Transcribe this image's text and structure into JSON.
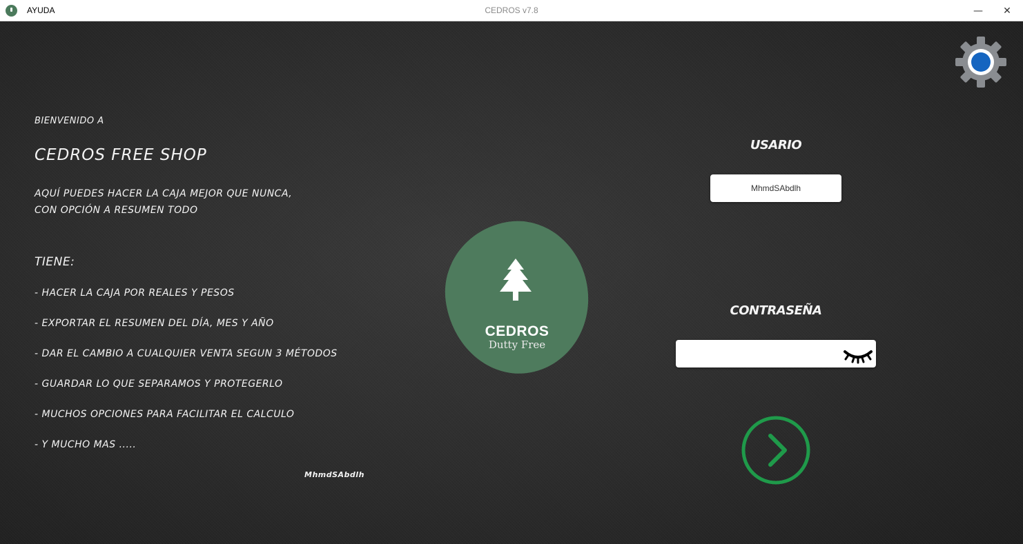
{
  "window": {
    "title": "CEDROS v7.8",
    "menu_ayuda": "AYUDA",
    "minimize_glyph": "—",
    "close_glyph": "✕"
  },
  "welcome": {
    "greeting": "BIENVENIDO A",
    "shop_name": "CEDROS FREE SHOP",
    "intro_line1": "AQUÍ PUEDES HACER LA CAJA MEJOR QUE NUNCA,",
    "intro_line2": "CON OPCIÓN A RESUMEN TODO",
    "features_title": "TIENE:",
    "features": [
      "- HACER LA CAJA POR REALES Y PESOS",
      "- EXPORTAR EL RESUMEN DEL DÍA, MES Y AÑO",
      "- DAR EL CAMBIO A CUALQUIER VENTA SEGUN 3 MÉTODOS",
      "- GUARDAR LO QUE SEPARAMOS Y PROTEGERLO",
      "- MUCHOS OPCIONES PARA FACILITAR EL CALCULO",
      "- Y MUCHO MAS ....."
    ],
    "signature": "MhmdSAbdlh"
  },
  "logo": {
    "brand": "CEDROS",
    "subtitle": "Dutty Free",
    "icon": "tree-icon",
    "color": "#4e7b5d"
  },
  "login": {
    "user_label": "USARIO",
    "user_value": "MhmdSAbdlh",
    "password_label": "CONTRASEÑA",
    "password_value": "",
    "show_password_icon": "closed-eye-icon",
    "submit_icon": "chevron-right-circle-icon",
    "accent_color": "#1f9a4a"
  },
  "settings": {
    "icon": "gear-icon"
  }
}
